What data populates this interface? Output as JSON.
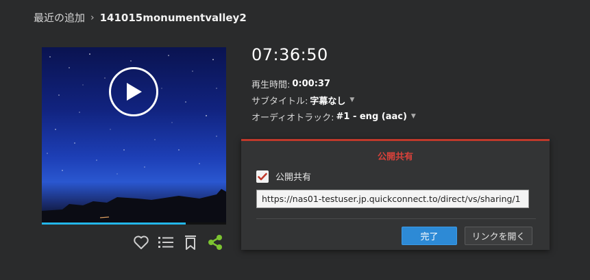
{
  "breadcrumb": {
    "parent": "最近の追加",
    "separator": "›",
    "current": "141015monumentvalley2"
  },
  "video": {
    "progress": 0.78,
    "accent_color": "#23b7ea",
    "play_icon": "play-icon"
  },
  "actions": {
    "icons": [
      "heart-icon",
      "list-icon",
      "bookmark-icon",
      "share-icon"
    ],
    "share_color": "#7cc431"
  },
  "info": {
    "title": "07:36:50",
    "duration_label": "再生時間:",
    "duration_value": "0:00:37",
    "subtitle_label": "サブタイトル:",
    "subtitle_value": "字幕なし",
    "audio_label": "オーディオトラック:",
    "audio_value": "#1 - eng (aac)"
  },
  "share_panel": {
    "title": "公開共有",
    "accent_color": "#c0392b",
    "checkbox_label": "公開共有",
    "checkbox_checked": true,
    "url": "https://nas01-testuser.jp.quickconnect.to/direct/vs/sharing/1",
    "done_label": "完了",
    "open_link_label": "リンクを開く"
  }
}
